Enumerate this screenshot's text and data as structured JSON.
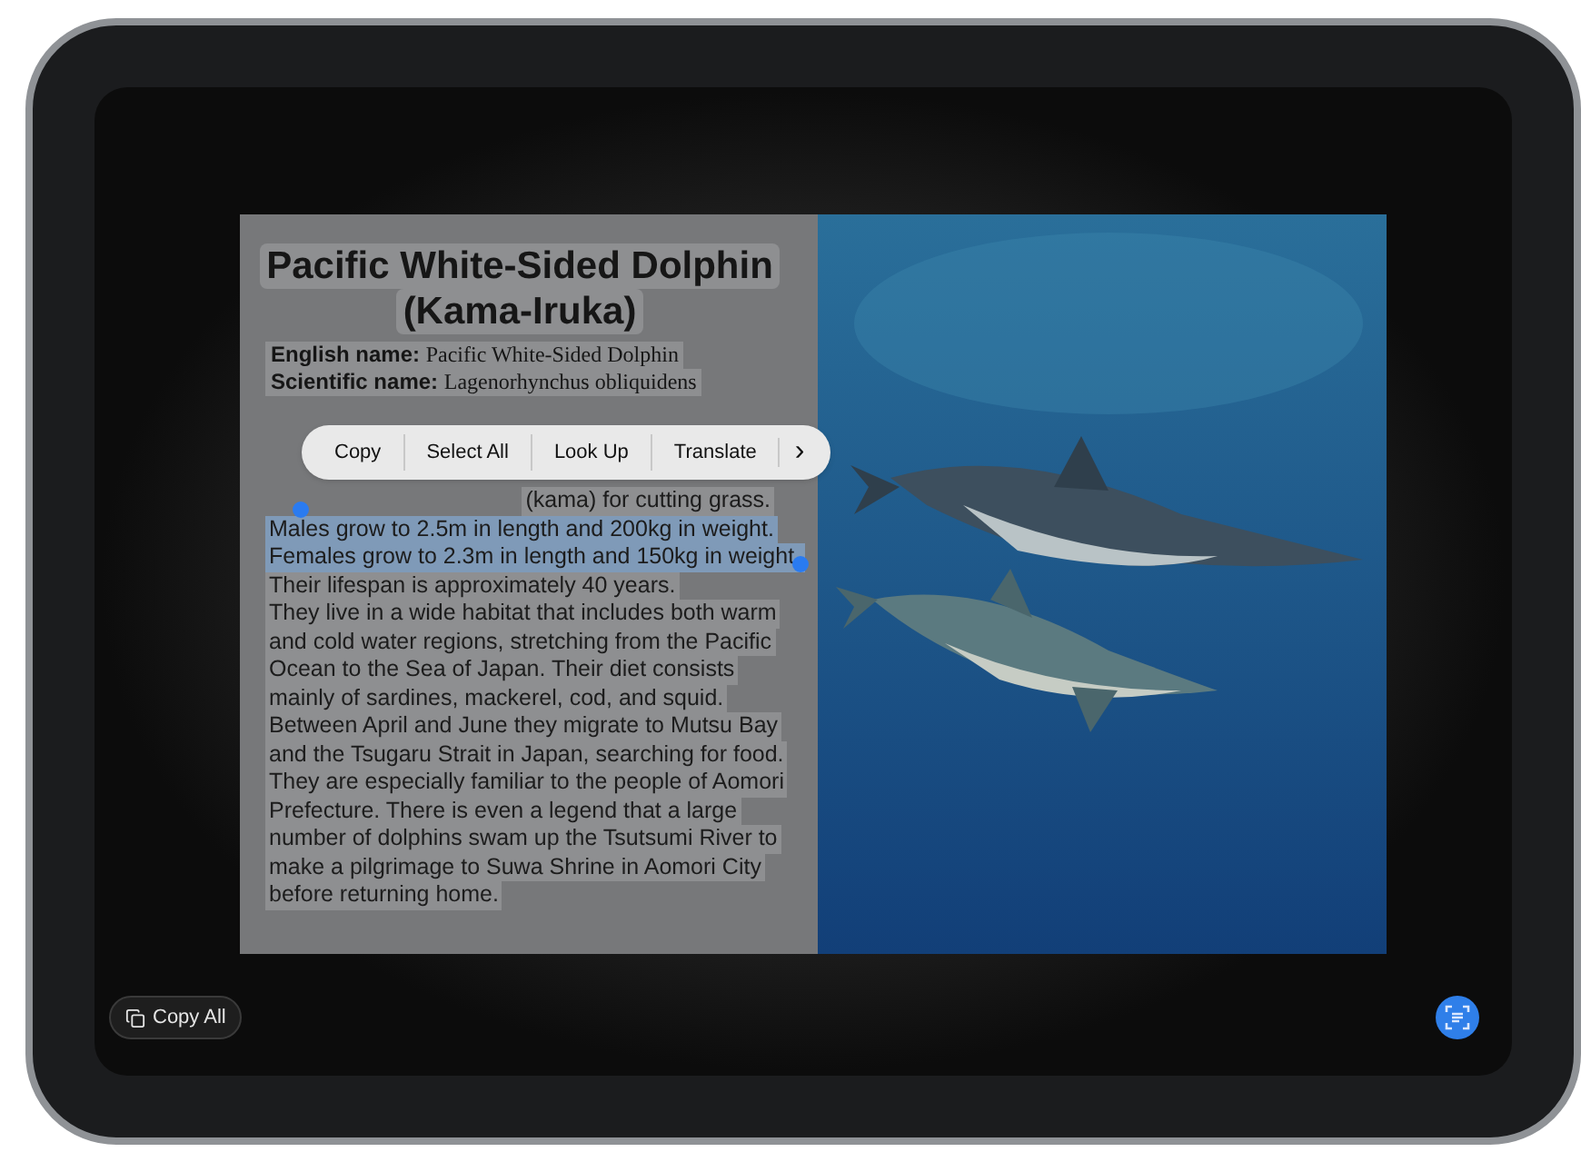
{
  "title": [
    "Pacific White-Sided Dolphin",
    "(Kama-Iruka)"
  ],
  "names": [
    {
      "label": "English name:",
      "value": "Pacific White-Sided Dolphin"
    },
    {
      "label": "Scientific name:",
      "value": "Lagenorhynchus obliquidens"
    }
  ],
  "partial_line": "(kama) for cutting grass.",
  "lines": [
    {
      "text": "Males grow to 2.5m in length and 200kg in weight.",
      "selected": true
    },
    {
      "text": "Females grow to 2.3m in length and 150kg in weight.",
      "selected": true
    },
    {
      "text": "Their lifespan is approximately 40 years.",
      "selected": false
    },
    {
      "text": "They live in a wide habitat that includes both warm",
      "selected": false
    },
    {
      "text": "and cold water regions, stretching from the Pacific",
      "selected": false
    },
    {
      "text": "Ocean to the Sea of Japan. Their diet consists",
      "selected": false
    },
    {
      "text": "mainly of sardines, mackerel, cod, and squid.",
      "selected": false
    },
    {
      "text": "Between April and June they migrate to Mutsu Bay",
      "selected": false
    },
    {
      "text": "and the Tsugaru Strait in Japan, searching for food.",
      "selected": false
    },
    {
      "text": "They are especially familiar to the people of Aomori",
      "selected": false
    },
    {
      "text": "Prefecture. There is even a legend that a large",
      "selected": false
    },
    {
      "text": "number of dolphins swam up the Tsutsumi River to",
      "selected": false
    },
    {
      "text": "make a pilgrimage to Suwa Shrine in Aomori City",
      "selected": false
    },
    {
      "text": "before returning home.",
      "selected": false
    }
  ],
  "menu": [
    "Copy",
    "Select All",
    "Look Up",
    "Translate"
  ],
  "more": "›",
  "copy_all": "Copy All"
}
